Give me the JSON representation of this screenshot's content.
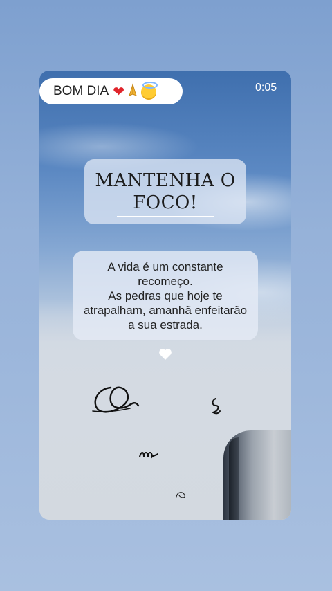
{
  "story": {
    "label_chip": {
      "text": "BOM DIA",
      "emojis": [
        "red-heart-emoji",
        "praying-hands-emoji",
        "smiling-face-with-halo-emoji"
      ]
    },
    "timer": "0:05",
    "title": "MANTENHA O FOCO!",
    "quote": "A vida é um constante\nrecomeço.\nAs pedras que hoje te\natrapalham, amanhã enfeitarão\na sua estrada.",
    "sticker_icon": "heart-icon",
    "colors": {
      "accent_heart": "#e0242b",
      "text_dark": "#1d1d1d",
      "timer_text": "#ffffff"
    }
  }
}
